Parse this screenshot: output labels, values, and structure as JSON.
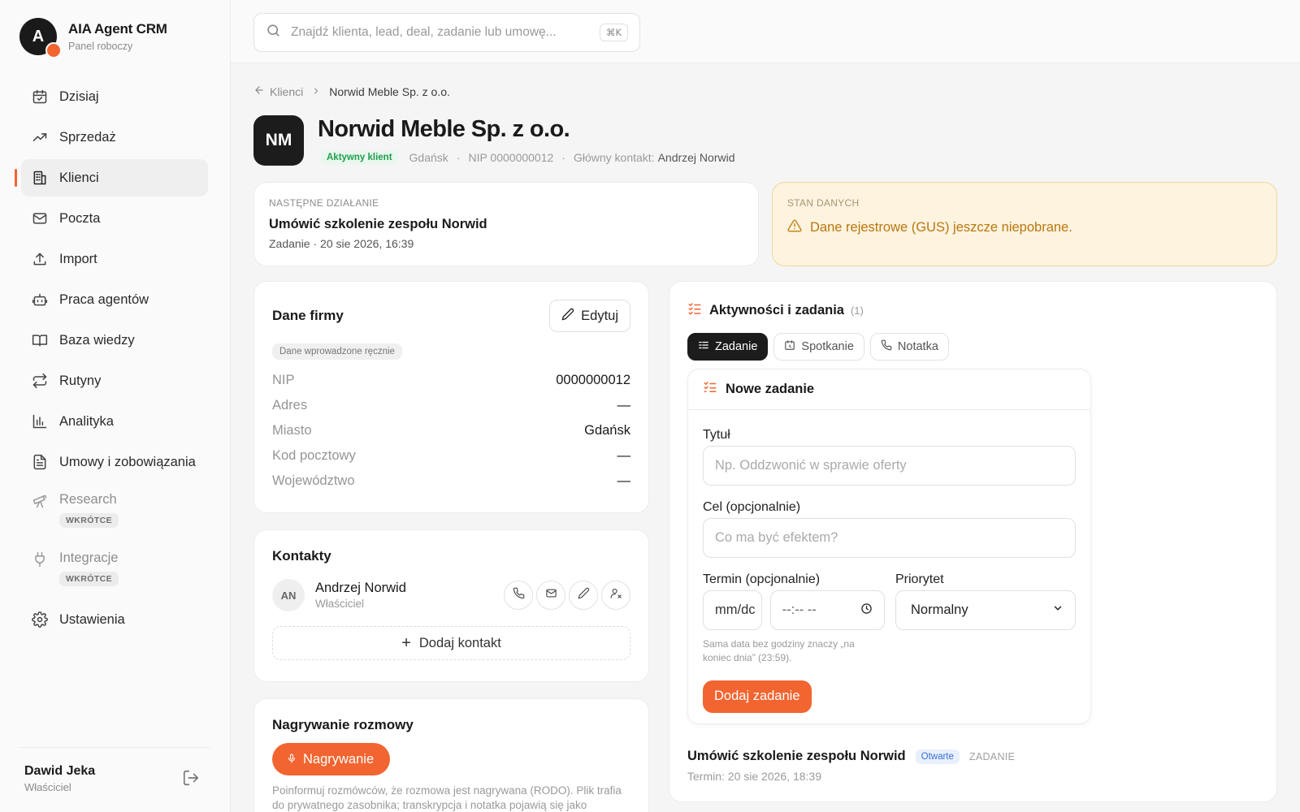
{
  "brand": {
    "initial": "A",
    "title": "AIA Agent CRM",
    "subtitle": "Panel roboczy"
  },
  "nav": [
    {
      "label": "Dzisiaj",
      "icon": "calendar-icon"
    },
    {
      "label": "Sprzedaż",
      "icon": "trend-icon"
    },
    {
      "label": "Klienci",
      "icon": "building-icon",
      "active": true
    },
    {
      "label": "Poczta",
      "icon": "mail-icon"
    },
    {
      "label": "Import",
      "icon": "upload-icon"
    },
    {
      "label": "Praca agentów",
      "icon": "bot-icon"
    },
    {
      "label": "Baza wiedzy",
      "icon": "book-icon"
    },
    {
      "label": "Rutyny",
      "icon": "repeat-icon"
    },
    {
      "label": "Analityka",
      "icon": "bar-chart-icon"
    },
    {
      "label": "Umowy i zobowiązania",
      "icon": "document-icon"
    },
    {
      "label": "Research",
      "icon": "telescope-icon",
      "badge": "WKRÓTCE"
    },
    {
      "label": "Integracje",
      "icon": "plug-icon",
      "badge": "WKRÓTCE"
    },
    {
      "label": "Ustawienia",
      "icon": "gear-icon"
    }
  ],
  "user": {
    "name": "Dawid Jeka",
    "role": "Właściciel"
  },
  "search": {
    "placeholder": "Znajdź klienta, lead, deal, zadanie lub umowę...",
    "shortcut": "⌘K"
  },
  "breadcrumb": {
    "back": "Klienci",
    "current": "Norwid Meble Sp. z o.o."
  },
  "company": {
    "initials": "NM",
    "name": "Norwid Meble Sp. z o.o.",
    "status": "Aktywny klient",
    "city": "Gdańsk",
    "nip": "NIP 0000000012",
    "main_contact_label": "Główny kontakt:",
    "main_contact": "Andrzej Norwid"
  },
  "next_action": {
    "label": "Następne działanie",
    "title": "Umówić szkolenie zespołu Norwid",
    "sub": "Zadanie · 20 sie 2026, 16:39"
  },
  "data_state": {
    "label": "Stan danych",
    "message": "Dane rejestrowe (GUS) jeszcze niepobrane."
  },
  "firm": {
    "title": "Dane firmy",
    "edit_label": "Edytuj",
    "source_tag": "Dane wprowadzone ręcznie",
    "fields": [
      {
        "k": "NIP",
        "v": "0000000012"
      },
      {
        "k": "Adres",
        "v": "—"
      },
      {
        "k": "Miasto",
        "v": "Gdańsk"
      },
      {
        "k": "Kod pocztowy",
        "v": "—"
      },
      {
        "k": "Województwo",
        "v": "—"
      }
    ]
  },
  "contacts": {
    "title": "Kontakty",
    "items": [
      {
        "initials": "AN",
        "name": "Andrzej Norwid",
        "role": "Właściciel"
      }
    ],
    "add_label": "Dodaj kontakt"
  },
  "recording": {
    "title": "Nagrywanie rozmowy",
    "button": "Nagrywanie",
    "text": "Poinformuj rozmówców, że rozmowa jest nagrywana (RODO). Plik trafia do prywatnego zasobnika; transkrypcja i notatka pojawią się jako"
  },
  "activities": {
    "title": "Aktywności i zadania",
    "count": "(1)",
    "tabs": [
      {
        "label": "Zadanie",
        "active": true
      },
      {
        "label": "Spotkanie"
      },
      {
        "label": "Notatka"
      }
    ],
    "new_task": {
      "title": "Nowe zadanie",
      "title_label": "Tytuł",
      "title_placeholder": "Np. Oddzwonić w sprawie oferty",
      "goal_label": "Cel (opcjonalnie)",
      "goal_placeholder": "Co ma być efektem?",
      "due_label": "Termin (opcjonalnie)",
      "date_value": "mm/dc",
      "time_value": "--:-- --",
      "priority_label": "Priorytet",
      "priority_value": "Normalny",
      "hint": "Sama data bez godziny znaczy „na koniec dnia” (23:59).",
      "submit": "Dodaj zadanie"
    },
    "items": [
      {
        "title": "Umówić szkolenie zespołu Norwid",
        "status": "Otwarte",
        "type": "ZADANIE",
        "due": "Termin: 20 sie 2026, 18:39"
      }
    ]
  },
  "colors": {
    "accent": "#f26430",
    "success": "#1f9d4c",
    "warning": "#b9770e",
    "info": "#3a6fd6"
  }
}
